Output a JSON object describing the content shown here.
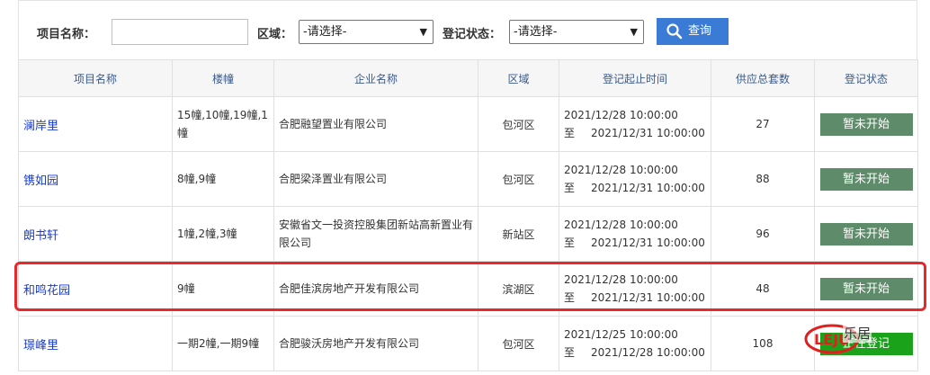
{
  "search": {
    "project_label": "项目名称：",
    "project_value": "",
    "region_label": "区域：",
    "region_selected": "-请选择-",
    "status_label": "登记状态：",
    "status_selected": "-请选择-",
    "query_label": "查询"
  },
  "table": {
    "headers": [
      "项目名称",
      "楼幢",
      "企业名称",
      "区域",
      "登记起止时间",
      "供应总套数",
      "登记状态"
    ],
    "rows": [
      {
        "name": "澜岸里",
        "buildings_l1": "15幢,10幢,19幢,1",
        "buildings_l2": "幢",
        "company_l1": "合肥融望置业有限公司",
        "company_l2": "",
        "area": "包河区",
        "start": "2021/12/28 10:00:00",
        "end_prefix": "至",
        "end": "2021/12/31 10:00:00",
        "count": "27",
        "status": "暂未开始"
      },
      {
        "name": "镌如园",
        "buildings_l1": "8幢,9幢",
        "buildings_l2": "",
        "company_l1": "合肥梁泽置业有限公司",
        "company_l2": "",
        "area": "包河区",
        "start": "2021/12/28 10:00:00",
        "end_prefix": "至",
        "end": "2021/12/31 10:00:00",
        "count": "88",
        "status": "暂未开始"
      },
      {
        "name": "朗书轩",
        "buildings_l1": "1幢,2幢,3幢",
        "buildings_l2": "",
        "company_l1": "安徽省文一投资控股集团新站高新置业有",
        "company_l2": "限公司",
        "area": "新站区",
        "start": "2021/12/28 10:00:00",
        "end_prefix": "至",
        "end": "2021/12/31 10:00:00",
        "count": "96",
        "status": "暂未开始"
      },
      {
        "name": "和鸣花园",
        "buildings_l1": "9幢",
        "buildings_l2": "",
        "company_l1": "合肥佳滨房地产开发有限公司",
        "company_l2": "",
        "area": "滨湖区",
        "start": "2021/12/28 10:00:00",
        "end_prefix": "至",
        "end": "2021/12/31 10:00:00",
        "count": "48",
        "status": "暂未开始"
      },
      {
        "name": "璟峰里",
        "buildings_l1": "一期2幢,一期9幢",
        "buildings_l2": "",
        "company_l1": "合肥骏沃房地产开发有限公司",
        "company_l2": "",
        "area": "包河区",
        "start": "2021/12/25 10:00:00",
        "end_prefix": "至",
        "end": "2021/12/28 10:00:00",
        "count": "108",
        "status": "正在登记"
      }
    ]
  },
  "colors": {
    "status_pending": "#5e8b6a",
    "status_active": "#1aa31a",
    "highlight": "#e8282a",
    "link": "#1a3cc8",
    "query_button": "#3a7bd5"
  },
  "watermark": {
    "logo_text": "LEJU",
    "text": "乐居"
  }
}
